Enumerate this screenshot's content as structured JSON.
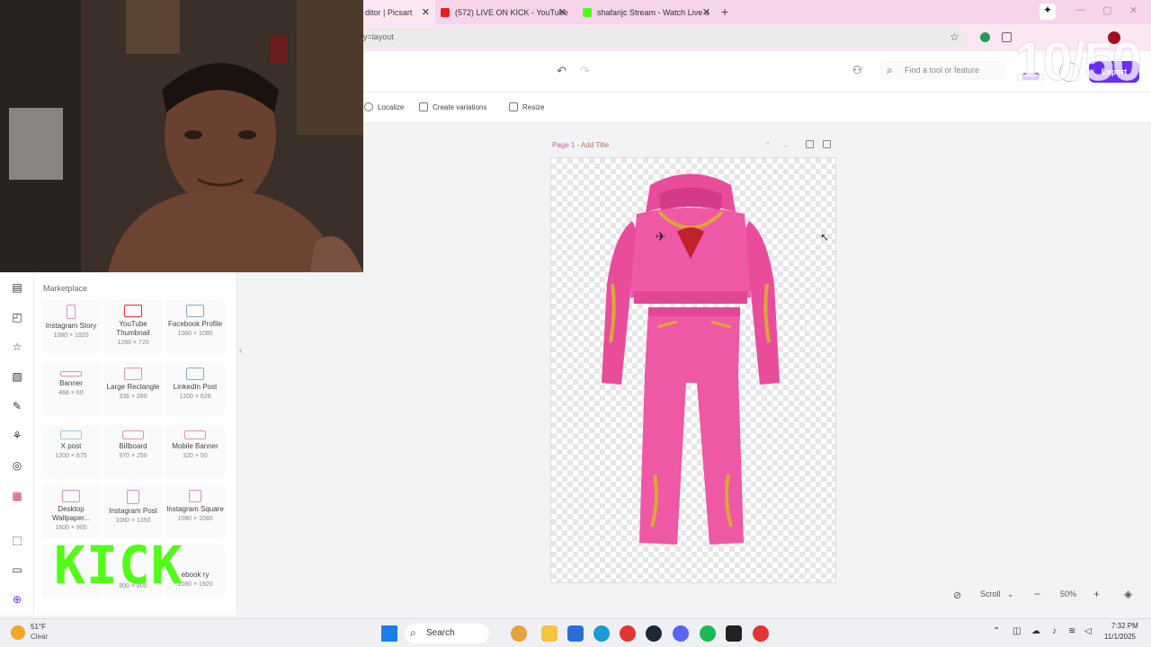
{
  "browser": {
    "tabs": [
      {
        "title": "ditor | Picsart",
        "active": true
      },
      {
        "title": "(572) LIVE ON KICK - YouTube",
        "active": false
      },
      {
        "title": "shafarijc Stream - Watch Live o",
        "active": false
      }
    ],
    "new_tab": "+",
    "address": "y=layout"
  },
  "app": {
    "search_placeholder": "Find a tool or feature",
    "pro_badge": "PRO",
    "export_label": "Export",
    "toolbar": {
      "localize": "Localize",
      "create_variations": "Create variations",
      "resize": "Resize"
    },
    "page_label": "Page 1",
    "page_title_placeholder": "- Add Title",
    "bottom": {
      "scroll_mode": "Scroll",
      "zoom": "50%"
    }
  },
  "marketplace": {
    "title": "Marketplace",
    "items": [
      {
        "label": "Instagram Story",
        "dim": "1080 × 1920"
      },
      {
        "label": "YouTube Thumbnail",
        "dim": "1280 × 720"
      },
      {
        "label": "Facebook Profile",
        "dim": "1080 × 1080"
      },
      {
        "label": "Banner",
        "dim": "468 × 60"
      },
      {
        "label": "Large Rectangle",
        "dim": "336 × 280"
      },
      {
        "label": "LinkedIn Post",
        "dim": "1200 × 628"
      },
      {
        "label": "X post",
        "dim": "1200 × 675"
      },
      {
        "label": "Billboard",
        "dim": "970 × 250"
      },
      {
        "label": "Mobile Banner",
        "dim": "320 × 50"
      },
      {
        "label": "Desktop Wallpaper...",
        "dim": "1600 × 900"
      },
      {
        "label": "Instagram Post",
        "dim": "1080 × 1350"
      },
      {
        "label": "Instagram Square",
        "dim": "1080 × 1080"
      },
      {
        "label": "",
        "dim": ""
      },
      {
        "label": "",
        "dim": "800 × 800"
      },
      {
        "label": "ebook ry",
        "dim": "1080 × 1920"
      }
    ]
  },
  "overlays": {
    "kick_logo": "KICK",
    "counter": "10/50"
  },
  "taskbar": {
    "weather_temp": "51°F",
    "weather_desc": "Clear",
    "search_label": "Search",
    "time": "7:32 PM",
    "date": "11/1/2025"
  },
  "colors": {
    "accent": "#6b2cf5",
    "tab_strip": "#f6d4ec",
    "kick_green": "#53fc18",
    "outfit_pink": "#ec4f9f"
  }
}
